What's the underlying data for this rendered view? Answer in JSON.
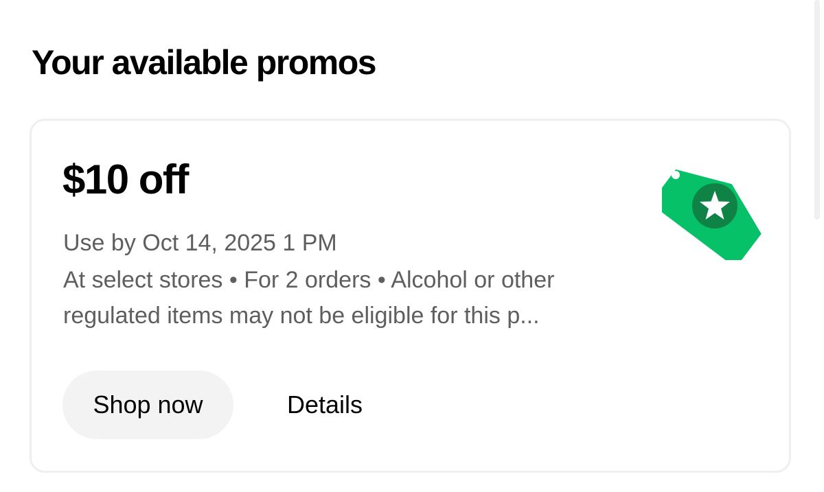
{
  "page": {
    "title": "Your available promos"
  },
  "promo": {
    "amount": "$10 off",
    "expiry": "Use by Oct 14, 2025 1 PM",
    "terms_line1": "At select stores • For 2 orders • Alcohol or other",
    "terms_line2": "regulated items may not be eligible for this p...",
    "icon": "promo-tag-star-icon",
    "icon_color": "#06c167",
    "icon_inner_color": "#0e8345"
  },
  "actions": {
    "shop_now_label": "Shop now",
    "details_label": "Details"
  }
}
